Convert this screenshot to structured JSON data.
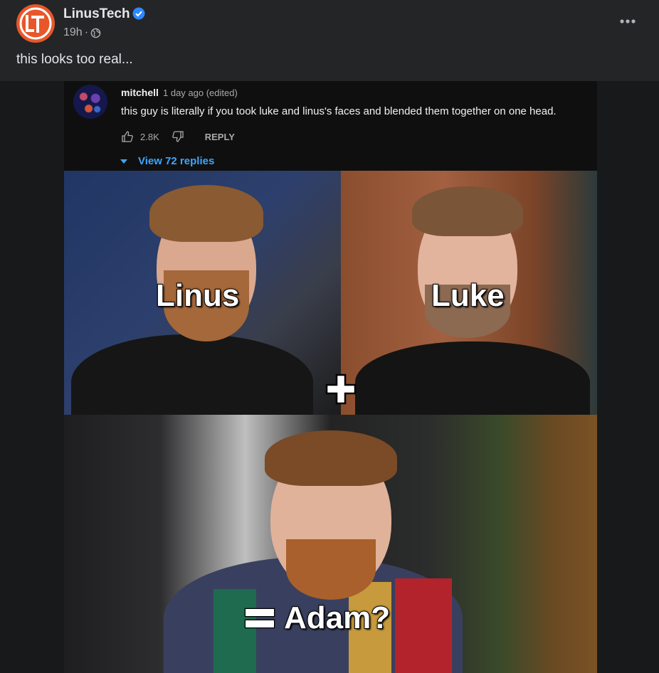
{
  "post": {
    "page_name": "LinusTech",
    "time": "19h",
    "separator": "·",
    "text": "this looks too real..."
  },
  "comment": {
    "user": "mitchell",
    "time": "1 day ago (edited)",
    "text": "this guy is literally if you took luke and linus's faces and blended them together on one head.",
    "likes": "2.8K",
    "reply_label": "REPLY",
    "view_replies": "View 72 replies"
  },
  "meme": {
    "label_left": "Linus",
    "label_right": "Luke",
    "label_bottom": "Adam?"
  },
  "colors": {
    "background": "#18191a",
    "card": "#242526",
    "brand": "#e8572a",
    "verified": "#2d88ff",
    "link_blue": "#3ea6ff"
  },
  "icons": [
    "lt-logo-icon",
    "verified-badge-icon",
    "globe-icon",
    "more-options-icon",
    "thumbs-up-icon",
    "thumbs-down-icon",
    "caret-down-icon",
    "plus-icon",
    "equals-icon"
  ]
}
